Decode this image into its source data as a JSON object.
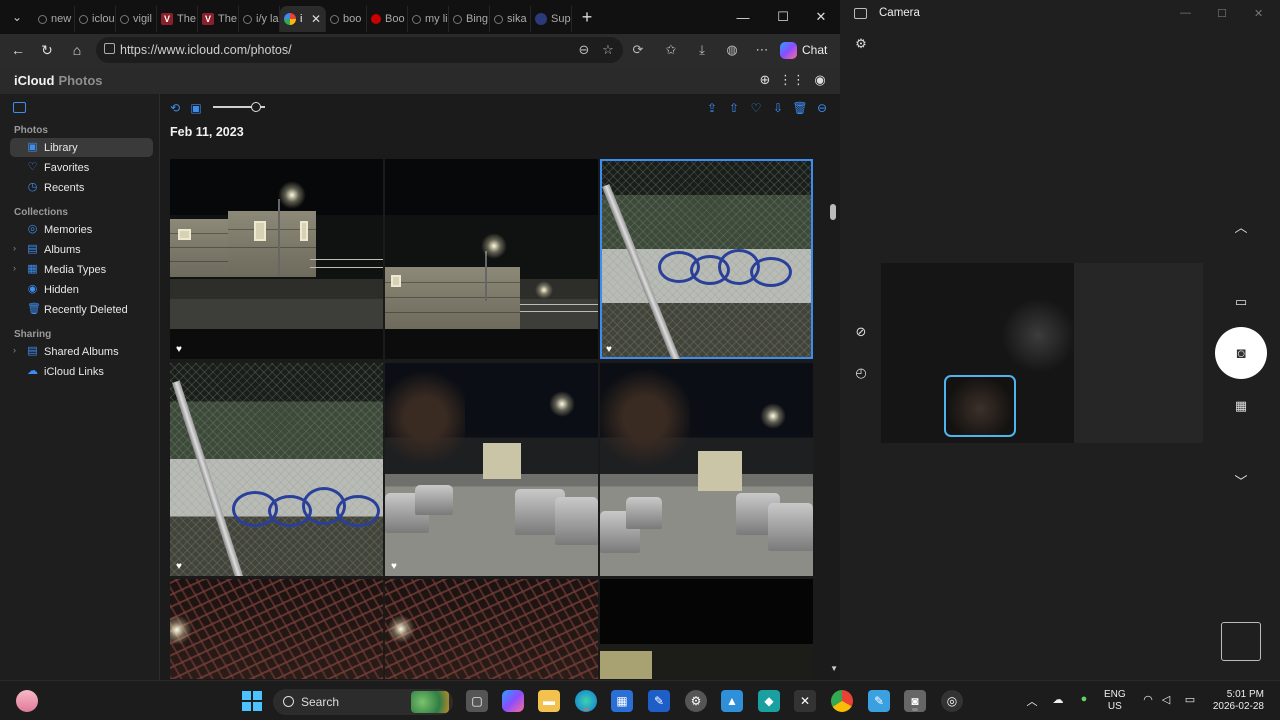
{
  "browser": {
    "tabs": [
      {
        "label": "new",
        "icon": "search-icon"
      },
      {
        "label": "iclou",
        "icon": "search-icon"
      },
      {
        "label": "vigil",
        "icon": "search-icon"
      },
      {
        "label": "The",
        "icon": "v-logo-icon"
      },
      {
        "label": "The",
        "icon": "v-logo-icon"
      },
      {
        "label": "i/y la",
        "icon": "search-icon"
      },
      {
        "label": "i",
        "icon": "icloud-photos-icon",
        "active": true
      },
      {
        "label": "boo",
        "icon": "search-icon"
      },
      {
        "label": "Boo",
        "icon": "red-circle-icon"
      },
      {
        "label": "my li",
        "icon": "search-icon"
      },
      {
        "label": "Bing",
        "icon": "search-icon"
      },
      {
        "label": "sika",
        "icon": "search-icon"
      },
      {
        "label": "Sup",
        "icon": "globe-icon"
      }
    ],
    "url": "https://www.icloud.com/photos/",
    "chat_label": "Chat"
  },
  "icloud": {
    "brand": "iCloud",
    "app": "Photos"
  },
  "sidebar": {
    "sections": [
      {
        "title": "Photos",
        "items": [
          {
            "label": "Library",
            "icon": "library-icon",
            "selected": true
          },
          {
            "label": "Favorites",
            "icon": "heart-icon"
          },
          {
            "label": "Recents",
            "icon": "clock-icon"
          }
        ]
      },
      {
        "title": "Collections",
        "items": [
          {
            "label": "Memories",
            "icon": "memories-icon"
          },
          {
            "label": "Albums",
            "icon": "albums-icon",
            "expandable": true
          },
          {
            "label": "Media Types",
            "icon": "media-types-icon",
            "expandable": true
          },
          {
            "label": "Hidden",
            "icon": "eye-icon"
          },
          {
            "label": "Recently Deleted",
            "icon": "trash-icon"
          }
        ]
      },
      {
        "title": "Sharing",
        "items": [
          {
            "label": "Shared Albums",
            "icon": "shared-albums-icon",
            "expandable": true
          },
          {
            "label": "iCloud Links",
            "icon": "cloud-link-icon"
          }
        ]
      }
    ]
  },
  "main": {
    "date_heading": "Feb 11, 2023"
  },
  "camera": {
    "title": "Camera"
  },
  "taskbar": {
    "search_label": "Search",
    "language": "ENG",
    "region": "US",
    "time": "5:01 PM",
    "date": "2026-02-28"
  },
  "colors": {
    "accent": "#3d8cf0",
    "thumb_border": "#4fb3f0"
  }
}
